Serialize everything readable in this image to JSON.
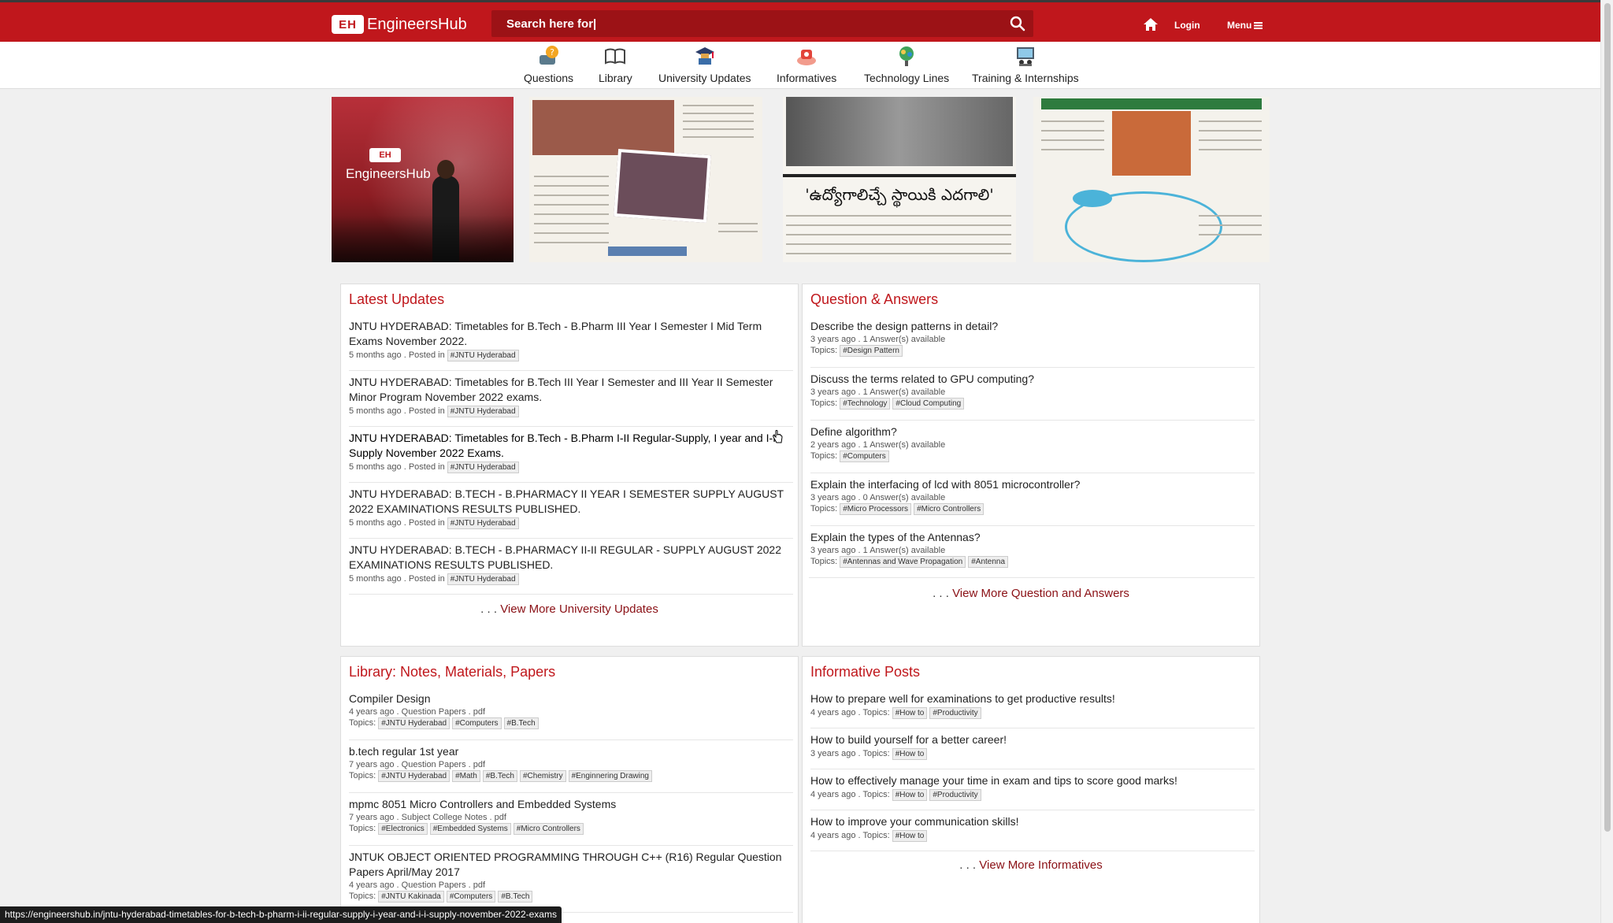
{
  "header": {
    "logo_mark": "EH",
    "logo_text": "EngineersHub",
    "search_value": "Search here for|",
    "login": "Login",
    "menu": "Menu"
  },
  "nav": [
    {
      "label": "Questions",
      "icon": "question-icon"
    },
    {
      "label": "Library",
      "icon": "book-icon"
    },
    {
      "label": "University Updates",
      "icon": "graduation-cap-icon"
    },
    {
      "label": "Informatives",
      "icon": "info-icon"
    },
    {
      "label": "Technology Lines",
      "icon": "technology-icon"
    },
    {
      "label": "Training & Internships",
      "icon": "training-icon"
    }
  ],
  "banners": {
    "b1_text": "EngineersHub",
    "b3_headline": "'ఉద్యోగాలిచ్చే స్థాయికి ఎదగాలి'"
  },
  "latest": {
    "title": "Latest Updates",
    "items": [
      {
        "title": "JNTU HYDERABAD: Timetables for B.Tech - B.Pharm III Year I Semester I Mid Term Exams November 2022.",
        "meta": "5 months ago . Posted in",
        "tag": "#JNTU Hyderabad"
      },
      {
        "title": "JNTU HYDERABAD: Timetables for B.Tech III Year I Semester and III Year II Semester Minor Program November 2022 exams.",
        "meta": "5 months ago . Posted in",
        "tag": "#JNTU Hyderabad"
      },
      {
        "title": "JNTU HYDERABAD: Timetables for B.Tech - B.Pharm I-II Regular-Supply, I year and I-I Supply November 2022 Exams.",
        "meta": "5 months ago . Posted in",
        "tag": "#JNTU Hyderabad"
      },
      {
        "title": "JNTU HYDERABAD: B.TECH - B.PHARMACY II YEAR I SEMESTER SUPPLY AUGUST 2022 EXAMINATIONS RESULTS PUBLISHED.",
        "meta": "5 months ago . Posted in",
        "tag": "#JNTU Hyderabad"
      },
      {
        "title": "JNTU HYDERABAD: B.TECH - B.PHARMACY II-II REGULAR - SUPPLY AUGUST 2022 EXAMINATIONS RESULTS PUBLISHED.",
        "meta": "5 months ago . Posted in",
        "tag": "#JNTU Hyderabad"
      }
    ],
    "more_dots": ". . .",
    "more": "View More University Updates"
  },
  "qa": {
    "title": "Question & Answers",
    "topics_label": "Topics:",
    "items": [
      {
        "title": "Describe the design patterns in detail?",
        "meta": "3 years ago . 1 Answer(s) available",
        "tags": [
          "#Design Pattern"
        ]
      },
      {
        "title": "Discuss the terms related to GPU computing?",
        "meta": "3 years ago . 1 Answer(s) available",
        "tags": [
          "#Technology",
          "#Cloud Computing"
        ]
      },
      {
        "title": "Define algorithm?",
        "meta": "2 years ago . 1 Answer(s) available",
        "tags": [
          "#Computers"
        ]
      },
      {
        "title": "Explain the interfacing of lcd with 8051 microcontroller?",
        "meta": "3 years ago . 0 Answer(s) available",
        "tags": [
          "#Micro Processors",
          "#Micro Controllers"
        ]
      },
      {
        "title": "Explain the types of the Antennas?",
        "meta": "3 years ago . 1 Answer(s) available",
        "tags": [
          "#Antennas and Wave Propagation",
          "#Antenna"
        ]
      }
    ],
    "more_dots": ". . .",
    "more": "View More Question and Answers"
  },
  "library": {
    "title": "Library: Notes, Materials, Papers",
    "topics_label": "Topics:",
    "items": [
      {
        "title": "Compiler Design",
        "meta": "4 years ago . Question Papers . pdf",
        "tags": [
          "#JNTU Hyderabad",
          "#Computers",
          "#B.Tech"
        ]
      },
      {
        "title": "b.tech regular 1st year",
        "meta": "7 years ago . Question Papers . pdf",
        "tags": [
          "#JNTU Hyderabad",
          "#Math",
          "#B.Tech",
          "#Chemistry",
          "#Enginnering Drawing"
        ]
      },
      {
        "title": "mpmc 8051 Micro Controllers and Embedded Systems",
        "meta": "7 years ago . Subject College Notes . pdf",
        "tags": [
          "#Electronics",
          "#Embedded Systems",
          "#Micro Controllers"
        ]
      },
      {
        "title": "JNTUK OBJECT ORIENTED PROGRAMMING THROUGH C++ (R16) Regular Question Papers April/May 2017",
        "meta": "4 years ago . Question Papers . pdf",
        "tags": [
          "#JNTU Kakinada",
          "#Computers",
          "#B.Tech"
        ]
      }
    ]
  },
  "informative": {
    "title": "Informative Posts",
    "topics_label": "Topics:",
    "items": [
      {
        "title": "How to prepare well for examinations to get productive results!",
        "meta": "4 years ago . Topics:",
        "tags": [
          "#How to",
          "#Productivity"
        ]
      },
      {
        "title": "How to build yourself for a better career!",
        "meta": "3 years ago . Topics:",
        "tags": [
          "#How to"
        ]
      },
      {
        "title": "How to effectively manage your time in exam and tips to score good marks!",
        "meta": "4 years ago . Topics:",
        "tags": [
          "#How to",
          "#Productivity"
        ]
      },
      {
        "title": "How to improve your communication skills!",
        "meta": "4 years ago . Topics:",
        "tags": [
          "#How to"
        ]
      }
    ],
    "more_dots": ". . .",
    "more": "View More Informatives"
  },
  "status_url": "https://engineershub.in/jntu-hyderabad-timetables-for-b-tech-b-pharm-i-ii-regular-supply-i-year-and-i-i-supply-november-2022-exams",
  "colors": {
    "brand": "#c0171c",
    "link_more": "#8a1015"
  }
}
